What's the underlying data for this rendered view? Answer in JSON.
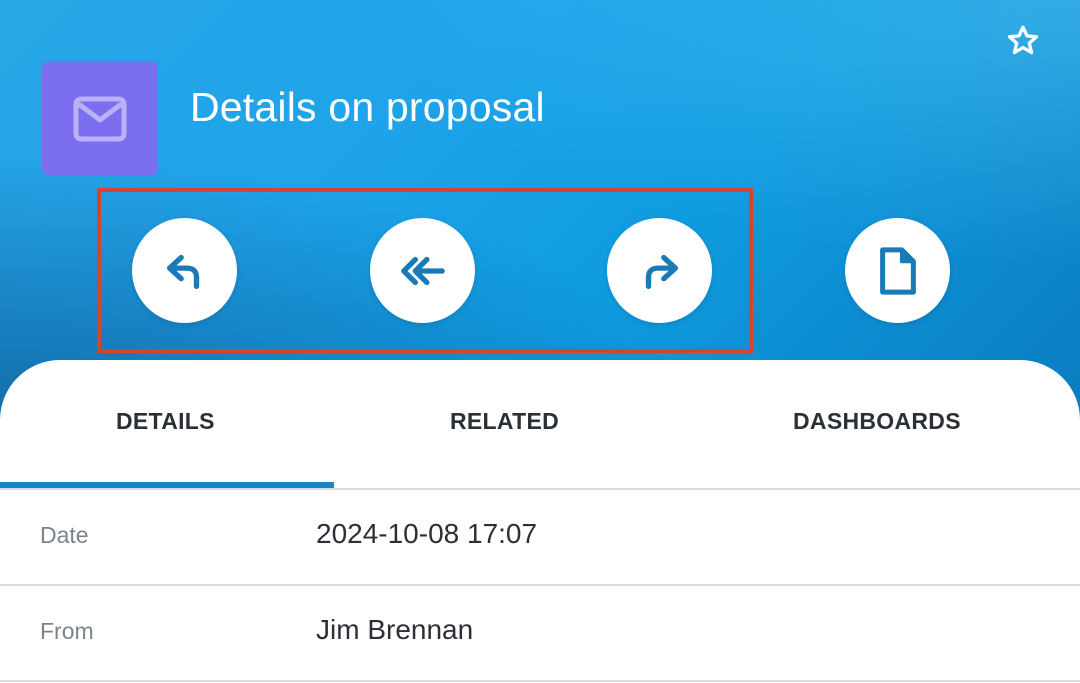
{
  "header": {
    "title": "Details on proposal",
    "record_icon": "envelope-icon",
    "favorite_icon": "star-outline-icon",
    "record_icon_color": "#7b6ff0"
  },
  "actions": [
    {
      "name": "reply",
      "icon": "reply-icon"
    },
    {
      "name": "reply-all",
      "icon": "reply-all-icon"
    },
    {
      "name": "forward",
      "icon": "forward-icon"
    },
    {
      "name": "document",
      "icon": "document-icon"
    }
  ],
  "tabs": [
    {
      "label": "DETAILS",
      "active": true
    },
    {
      "label": "RELATED",
      "active": false
    },
    {
      "label": "DASHBOARDS",
      "active": false
    }
  ],
  "fields": [
    {
      "label": "Date",
      "value": "2024-10-08 17:07"
    },
    {
      "label": "From",
      "value": "Jim Brennan"
    }
  ],
  "colors": {
    "accent": "#1e83c6",
    "highlight": "#d9432e",
    "icon": "#1a7ab8"
  }
}
